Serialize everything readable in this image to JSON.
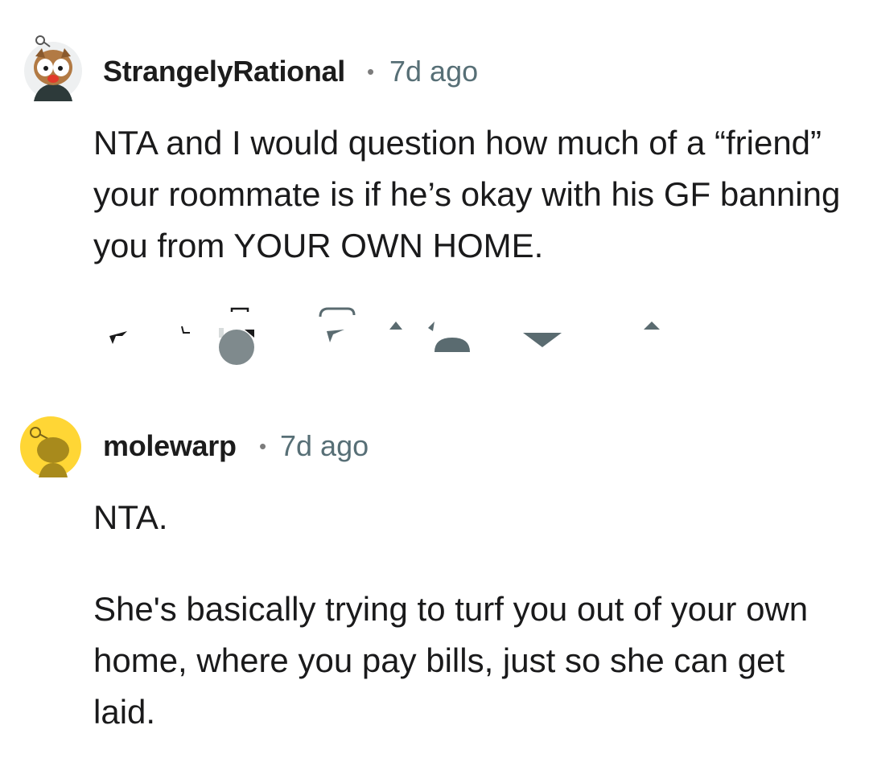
{
  "comments": [
    {
      "author": "StrangelyRational",
      "separator": "•",
      "time": "7d ago",
      "body": "NTA and I would question how much of a “friend” your roommate is if he’s okay with his GF banning you from YOUR OWN HOME.",
      "avatar_icon": "owl-snoo-avatar-icon"
    },
    {
      "author": "molewarp",
      "separator": "•",
      "time": "7d ago",
      "body_paragraphs": [
        "NTA.",
        "She's basically trying to turf you out of your own home, where you pay bills, just so she can get laid."
      ],
      "avatar_icon": "default-snoo-avatar-icon"
    }
  ],
  "colors": {
    "text": "#1a1a1b",
    "meta": "#576f76",
    "avatar_yellow": "#ffd635",
    "icon_gray": "#5a6b70"
  }
}
